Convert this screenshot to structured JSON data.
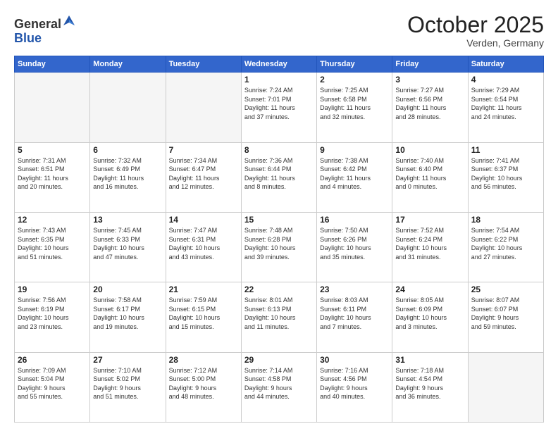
{
  "header": {
    "logo": {
      "line1": "General",
      "line2": "Blue"
    },
    "title": "October 2025",
    "location": "Verden, Germany"
  },
  "weekdays": [
    "Sunday",
    "Monday",
    "Tuesday",
    "Wednesday",
    "Thursday",
    "Friday",
    "Saturday"
  ],
  "weeks": [
    [
      {
        "day": "",
        "info": ""
      },
      {
        "day": "",
        "info": ""
      },
      {
        "day": "",
        "info": ""
      },
      {
        "day": "1",
        "info": "Sunrise: 7:24 AM\nSunset: 7:01 PM\nDaylight: 11 hours\nand 37 minutes."
      },
      {
        "day": "2",
        "info": "Sunrise: 7:25 AM\nSunset: 6:58 PM\nDaylight: 11 hours\nand 32 minutes."
      },
      {
        "day": "3",
        "info": "Sunrise: 7:27 AM\nSunset: 6:56 PM\nDaylight: 11 hours\nand 28 minutes."
      },
      {
        "day": "4",
        "info": "Sunrise: 7:29 AM\nSunset: 6:54 PM\nDaylight: 11 hours\nand 24 minutes."
      }
    ],
    [
      {
        "day": "5",
        "info": "Sunrise: 7:31 AM\nSunset: 6:51 PM\nDaylight: 11 hours\nand 20 minutes."
      },
      {
        "day": "6",
        "info": "Sunrise: 7:32 AM\nSunset: 6:49 PM\nDaylight: 11 hours\nand 16 minutes."
      },
      {
        "day": "7",
        "info": "Sunrise: 7:34 AM\nSunset: 6:47 PM\nDaylight: 11 hours\nand 12 minutes."
      },
      {
        "day": "8",
        "info": "Sunrise: 7:36 AM\nSunset: 6:44 PM\nDaylight: 11 hours\nand 8 minutes."
      },
      {
        "day": "9",
        "info": "Sunrise: 7:38 AM\nSunset: 6:42 PM\nDaylight: 11 hours\nand 4 minutes."
      },
      {
        "day": "10",
        "info": "Sunrise: 7:40 AM\nSunset: 6:40 PM\nDaylight: 11 hours\nand 0 minutes."
      },
      {
        "day": "11",
        "info": "Sunrise: 7:41 AM\nSunset: 6:37 PM\nDaylight: 10 hours\nand 56 minutes."
      }
    ],
    [
      {
        "day": "12",
        "info": "Sunrise: 7:43 AM\nSunset: 6:35 PM\nDaylight: 10 hours\nand 51 minutes."
      },
      {
        "day": "13",
        "info": "Sunrise: 7:45 AM\nSunset: 6:33 PM\nDaylight: 10 hours\nand 47 minutes."
      },
      {
        "day": "14",
        "info": "Sunrise: 7:47 AM\nSunset: 6:31 PM\nDaylight: 10 hours\nand 43 minutes."
      },
      {
        "day": "15",
        "info": "Sunrise: 7:48 AM\nSunset: 6:28 PM\nDaylight: 10 hours\nand 39 minutes."
      },
      {
        "day": "16",
        "info": "Sunrise: 7:50 AM\nSunset: 6:26 PM\nDaylight: 10 hours\nand 35 minutes."
      },
      {
        "day": "17",
        "info": "Sunrise: 7:52 AM\nSunset: 6:24 PM\nDaylight: 10 hours\nand 31 minutes."
      },
      {
        "day": "18",
        "info": "Sunrise: 7:54 AM\nSunset: 6:22 PM\nDaylight: 10 hours\nand 27 minutes."
      }
    ],
    [
      {
        "day": "19",
        "info": "Sunrise: 7:56 AM\nSunset: 6:19 PM\nDaylight: 10 hours\nand 23 minutes."
      },
      {
        "day": "20",
        "info": "Sunrise: 7:58 AM\nSunset: 6:17 PM\nDaylight: 10 hours\nand 19 minutes."
      },
      {
        "day": "21",
        "info": "Sunrise: 7:59 AM\nSunset: 6:15 PM\nDaylight: 10 hours\nand 15 minutes."
      },
      {
        "day": "22",
        "info": "Sunrise: 8:01 AM\nSunset: 6:13 PM\nDaylight: 10 hours\nand 11 minutes."
      },
      {
        "day": "23",
        "info": "Sunrise: 8:03 AM\nSunset: 6:11 PM\nDaylight: 10 hours\nand 7 minutes."
      },
      {
        "day": "24",
        "info": "Sunrise: 8:05 AM\nSunset: 6:09 PM\nDaylight: 10 hours\nand 3 minutes."
      },
      {
        "day": "25",
        "info": "Sunrise: 8:07 AM\nSunset: 6:07 PM\nDaylight: 9 hours\nand 59 minutes."
      }
    ],
    [
      {
        "day": "26",
        "info": "Sunrise: 7:09 AM\nSunset: 5:04 PM\nDaylight: 9 hours\nand 55 minutes."
      },
      {
        "day": "27",
        "info": "Sunrise: 7:10 AM\nSunset: 5:02 PM\nDaylight: 9 hours\nand 51 minutes."
      },
      {
        "day": "28",
        "info": "Sunrise: 7:12 AM\nSunset: 5:00 PM\nDaylight: 9 hours\nand 48 minutes."
      },
      {
        "day": "29",
        "info": "Sunrise: 7:14 AM\nSunset: 4:58 PM\nDaylight: 9 hours\nand 44 minutes."
      },
      {
        "day": "30",
        "info": "Sunrise: 7:16 AM\nSunset: 4:56 PM\nDaylight: 9 hours\nand 40 minutes."
      },
      {
        "day": "31",
        "info": "Sunrise: 7:18 AM\nSunset: 4:54 PM\nDaylight: 9 hours\nand 36 minutes."
      },
      {
        "day": "",
        "info": ""
      }
    ]
  ]
}
